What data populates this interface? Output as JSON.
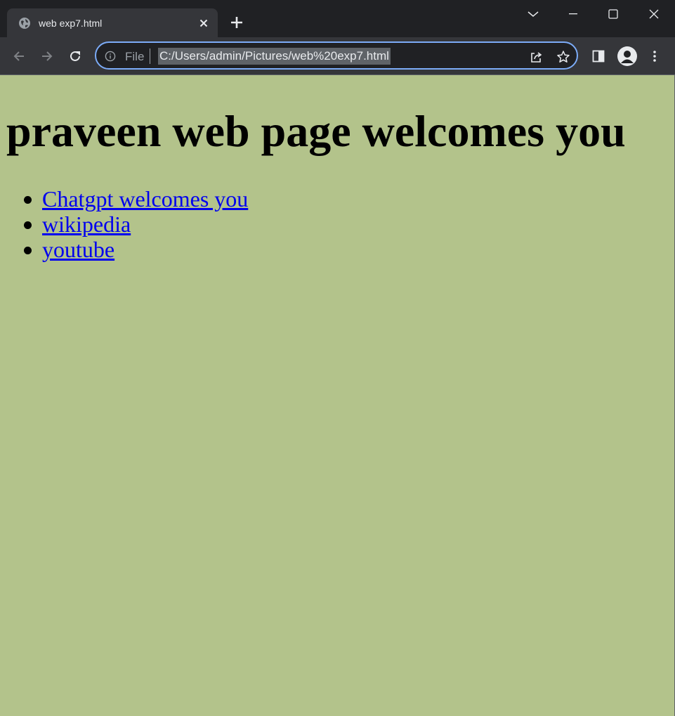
{
  "browser": {
    "tab_title": "web exp7.html",
    "scheme_label": "File",
    "address": "C:/Users/admin/Pictures/web%20exp7.html",
    "icons": {
      "favicon": "globe-icon",
      "tab_close": "close-icon",
      "new_tab": "plus-icon",
      "tab_search": "chevron-down-icon",
      "minimize": "minimize-icon",
      "maximize": "maximize-icon",
      "close_window": "close-icon",
      "back": "back-arrow-icon",
      "forward": "forward-arrow-icon",
      "reload": "reload-icon",
      "site_info": "info-icon",
      "share": "share-icon",
      "bookmark": "star-icon",
      "side_panel": "side-panel-icon",
      "profile": "avatar-icon",
      "menu": "kebab-menu-icon"
    },
    "colors": {
      "frame": "#202124",
      "toolbar": "#35363a",
      "focus_ring": "#7cacf8"
    }
  },
  "page": {
    "background": "#b3c38b",
    "heading": "praveen web page welcomes you",
    "links": [
      {
        "label": "Chatgpt welcomes you"
      },
      {
        "label": "wikipedia"
      },
      {
        "label": "youtube"
      }
    ],
    "link_color": "#0000ee"
  }
}
